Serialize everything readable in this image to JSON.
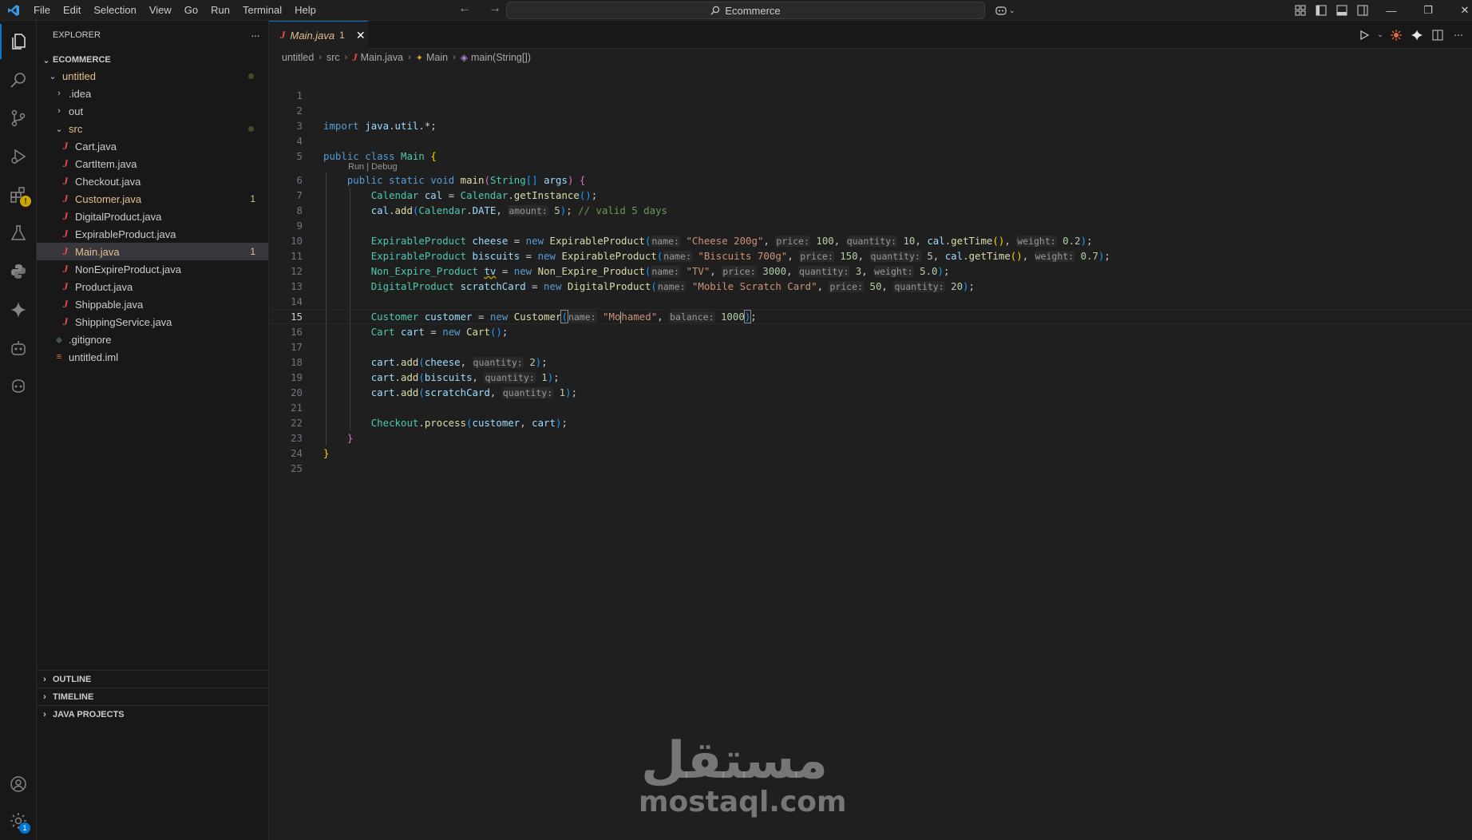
{
  "titlebar": {
    "menu": [
      "File",
      "Edit",
      "Selection",
      "View",
      "Go",
      "Run",
      "Terminal",
      "Help"
    ],
    "search_text": "Ecommerce"
  },
  "sidebar": {
    "header": "EXPLORER",
    "more_label": "···",
    "project": "ECOMMERCE",
    "tree": [
      {
        "label": "untitled",
        "kind": "folder-open",
        "depth": 1,
        "modified": true
      },
      {
        "label": ".idea",
        "kind": "folder",
        "depth": 2
      },
      {
        "label": "out",
        "kind": "folder",
        "depth": 2
      },
      {
        "label": "src",
        "kind": "folder-open",
        "depth": 2,
        "modified": true
      },
      {
        "label": "Cart.java",
        "kind": "java",
        "depth": 3
      },
      {
        "label": "CartItem.java",
        "kind": "java",
        "depth": 3
      },
      {
        "label": "Checkout.java",
        "kind": "java",
        "depth": 3
      },
      {
        "label": "Customer.java",
        "kind": "java",
        "depth": 3,
        "problems": "1"
      },
      {
        "label": "DigitalProduct.java",
        "kind": "java",
        "depth": 3
      },
      {
        "label": "ExpirableProduct.java",
        "kind": "java",
        "depth": 3
      },
      {
        "label": "Main.java",
        "kind": "java",
        "depth": 3,
        "problems": "1",
        "selected": true
      },
      {
        "label": "NonExpireProduct.java",
        "kind": "java",
        "depth": 3
      },
      {
        "label": "Product.java",
        "kind": "java",
        "depth": 3
      },
      {
        "label": "Shippable.java",
        "kind": "java",
        "depth": 3
      },
      {
        "label": "ShippingService.java",
        "kind": "java",
        "depth": 3
      },
      {
        "label": ".gitignore",
        "kind": "gitignore",
        "depth": 2
      },
      {
        "label": "untitled.iml",
        "kind": "iml",
        "depth": 2
      }
    ],
    "sections": [
      "OUTLINE",
      "TIMELINE",
      "JAVA PROJECTS"
    ]
  },
  "activitybar": {
    "accounts_badge": "",
    "settings_badge": "1",
    "extensions_warning": "!"
  },
  "editor": {
    "tab": {
      "name": "Main.java",
      "problems": "1"
    },
    "breadcrumb": [
      "untitled",
      "src",
      "Main.java",
      "Main",
      "main(String[])"
    ],
    "codelens": "Run | Debug",
    "line_numbers": [
      "1",
      "2",
      "3",
      "4",
      "5",
      "6",
      "7",
      "8",
      "9",
      "10",
      "11",
      "12",
      "13",
      "14",
      "15",
      "16",
      "17",
      "18",
      "19",
      "20",
      "21",
      "22",
      "23",
      "24",
      "25"
    ],
    "current_line": 15
  },
  "watermark": {
    "arabic": "مستقل",
    "latin": "mostaql.com"
  },
  "colors": {
    "accent": "#0078d4",
    "modified": "#e2c08d",
    "java_icon": "#f14c4c",
    "background": "#1f1f1f",
    "sidebar_bg": "#181818"
  }
}
